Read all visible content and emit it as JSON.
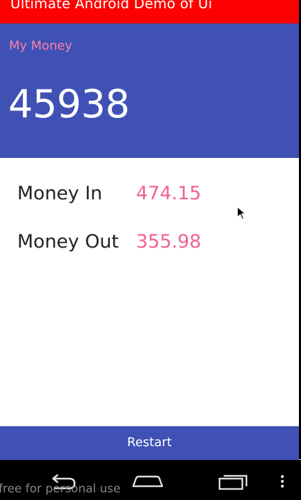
{
  "app": {
    "title": "Ultimate Android Demo of Ui"
  },
  "header": {
    "label": "My Money",
    "balance": "45938"
  },
  "rows": [
    {
      "label": "Money In",
      "value": "474.15"
    },
    {
      "label": "Money Out",
      "value": "355.98"
    }
  ],
  "footer": {
    "restart_label": "Restart"
  },
  "navigation": {
    "back_icon": "back-icon",
    "home_icon": "home-icon",
    "recents_icon": "recents-icon",
    "menu_icon": "overflow-menu-icon"
  },
  "watermark": "free for personal use",
  "colors": {
    "title_bar": "#ff0000",
    "primary": "#3f51b5",
    "accent": "#ff80ab",
    "value_text": "#f06292"
  }
}
